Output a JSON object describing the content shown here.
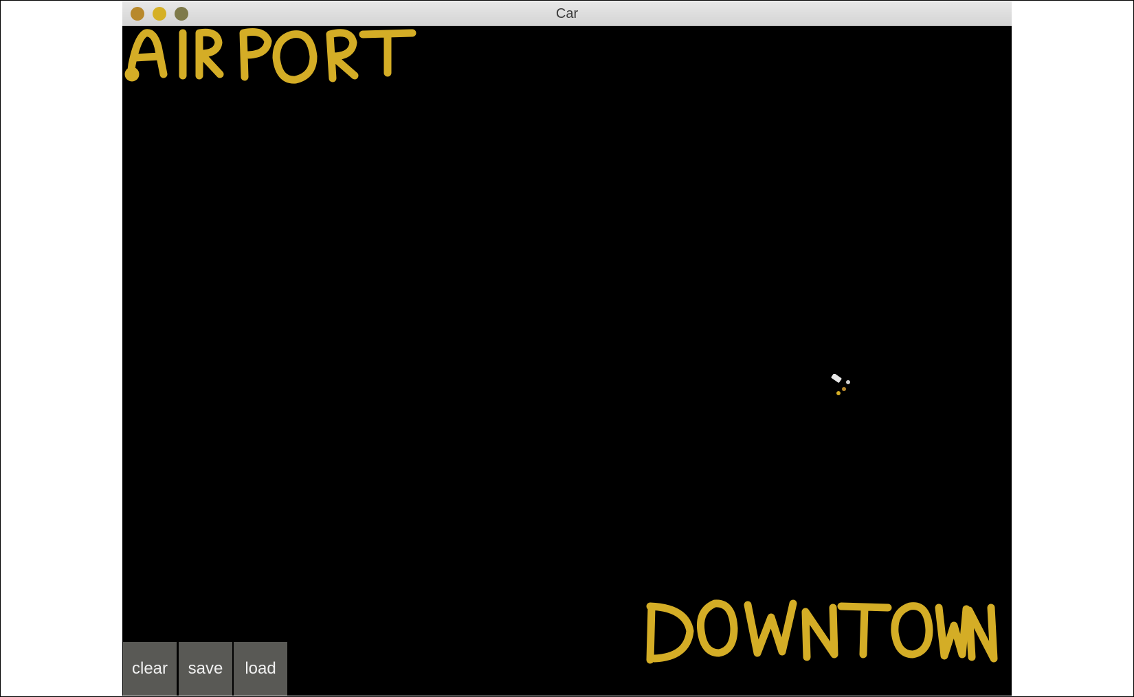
{
  "window": {
    "title": "Car"
  },
  "canvas": {
    "label_top": "AIRPORT",
    "label_bottom": "DOWNTOWN",
    "stroke_color": "#d4ad26",
    "background_color": "#000000"
  },
  "buttons": {
    "clear": "clear",
    "save": "save",
    "load": "load"
  },
  "icons": {
    "close": "close-button-icon",
    "minimize": "minimize-button-icon",
    "maximize": "maximize-button-icon",
    "car": "car-icon"
  }
}
